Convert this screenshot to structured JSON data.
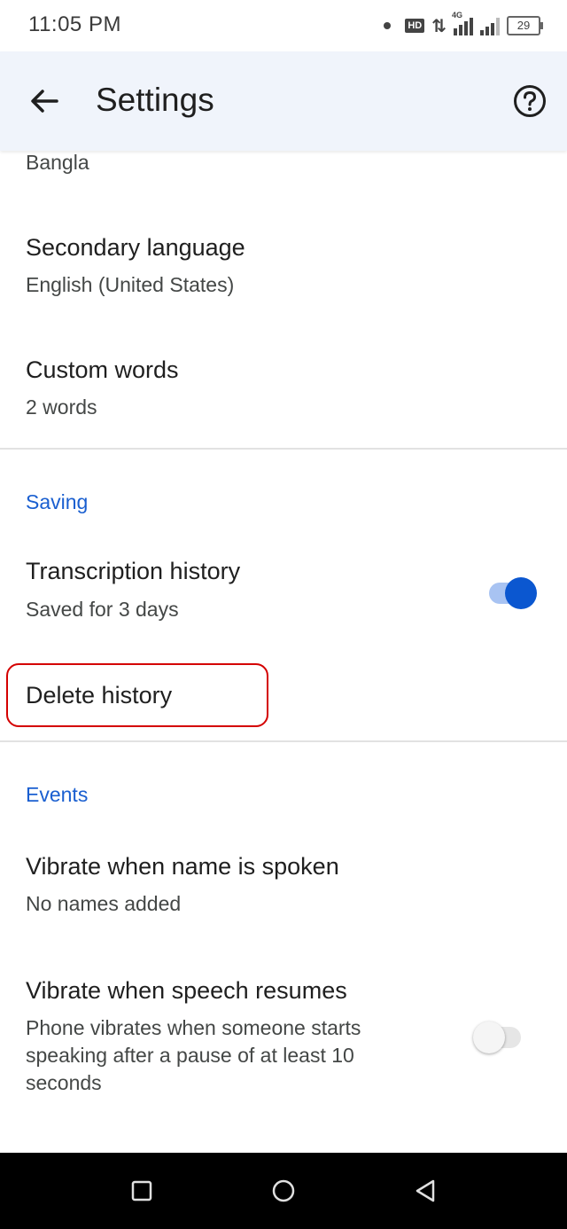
{
  "status_bar": {
    "time": "11:05 PM",
    "hd": "HD",
    "data_arrows": "⇅",
    "network_type": "4G",
    "battery": "29",
    "icons": [
      "dot-icon",
      "hd-icon",
      "data-arrows-icon",
      "signal-4g-icon",
      "signal-icon",
      "battery-icon"
    ]
  },
  "app_bar": {
    "title": "Settings",
    "back_icon": "arrow-back-icon",
    "help_icon": "help-circle-icon"
  },
  "language": {
    "primary_value": "Bangla",
    "secondary_title": "Secondary language",
    "secondary_value": "English (United States)",
    "custom_words_title": "Custom words",
    "custom_words_value": "2 words"
  },
  "saving": {
    "header": "Saving",
    "transcription_title": "Transcription history",
    "transcription_value": "Saved for 3 days",
    "transcription_enabled": true,
    "delete_history": "Delete history"
  },
  "events": {
    "header": "Events",
    "vibrate_name_title": "Vibrate when name is spoken",
    "vibrate_name_value": "No names added",
    "vibrate_speech_title": "Vibrate when speech resumes",
    "vibrate_speech_desc_line1": "Phone vibrates when someone starts",
    "vibrate_speech_desc_line2": "speaking after a pause of at least 10",
    "vibrate_speech_desc_line3": "seconds",
    "vibrate_speech_enabled": false
  },
  "nav_bar": {
    "icons": [
      "recents-square-icon",
      "home-circle-icon",
      "back-triangle-icon"
    ]
  },
  "colors": {
    "accent": "#0b57d0",
    "section_header": "#1a5fd0",
    "app_bar_bg": "#f0f4fb",
    "highlight": "#d40000"
  }
}
